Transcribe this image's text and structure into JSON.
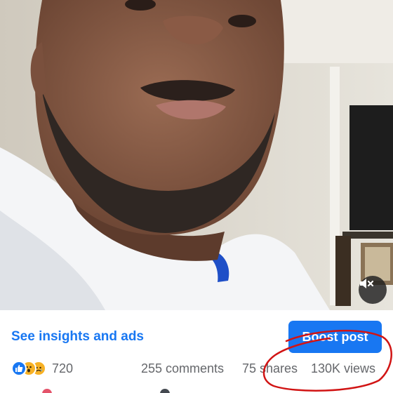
{
  "video": {
    "mute_icon": "speaker-muted-icon"
  },
  "post_actions": {
    "insights_label": "See insights and ads",
    "boost_label": "Boost post"
  },
  "stats": {
    "reactions": [
      "like",
      "wow",
      "sad"
    ],
    "reaction_count": "720",
    "comments": "255 comments",
    "shares": "75 shares",
    "views": "130K views"
  },
  "colors": {
    "accent": "#1877f2",
    "secondary_text": "#65676b",
    "annotation": "#d11414"
  }
}
